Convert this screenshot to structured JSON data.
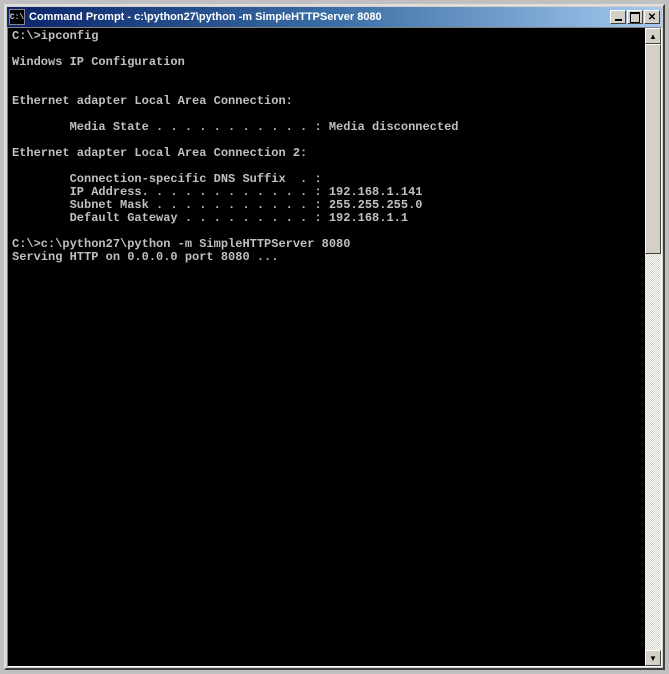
{
  "window": {
    "title": "Command Prompt - c:\\python27\\python -m SimpleHTTPServer 8080",
    "icon_label": "C:\\"
  },
  "console": {
    "lines": [
      "C:\\>ipconfig",
      "",
      "Windows IP Configuration",
      "",
      "",
      "Ethernet adapter Local Area Connection:",
      "",
      "        Media State . . . . . . . . . . . : Media disconnected",
      "",
      "Ethernet adapter Local Area Connection 2:",
      "",
      "        Connection-specific DNS Suffix  . :",
      "        IP Address. . . . . . . . . . . . : 192.168.1.141",
      "        Subnet Mask . . . . . . . . . . . : 255.255.255.0",
      "        Default Gateway . . . . . . . . . : 192.168.1.1",
      "",
      "C:\\>c:\\python27\\python -m SimpleHTTPServer 8080",
      "Serving HTTP on 0.0.0.0 port 8080 ..."
    ]
  },
  "scrollbar": {
    "up": "▲",
    "down": "▼"
  },
  "controls": {
    "close": "✕"
  }
}
